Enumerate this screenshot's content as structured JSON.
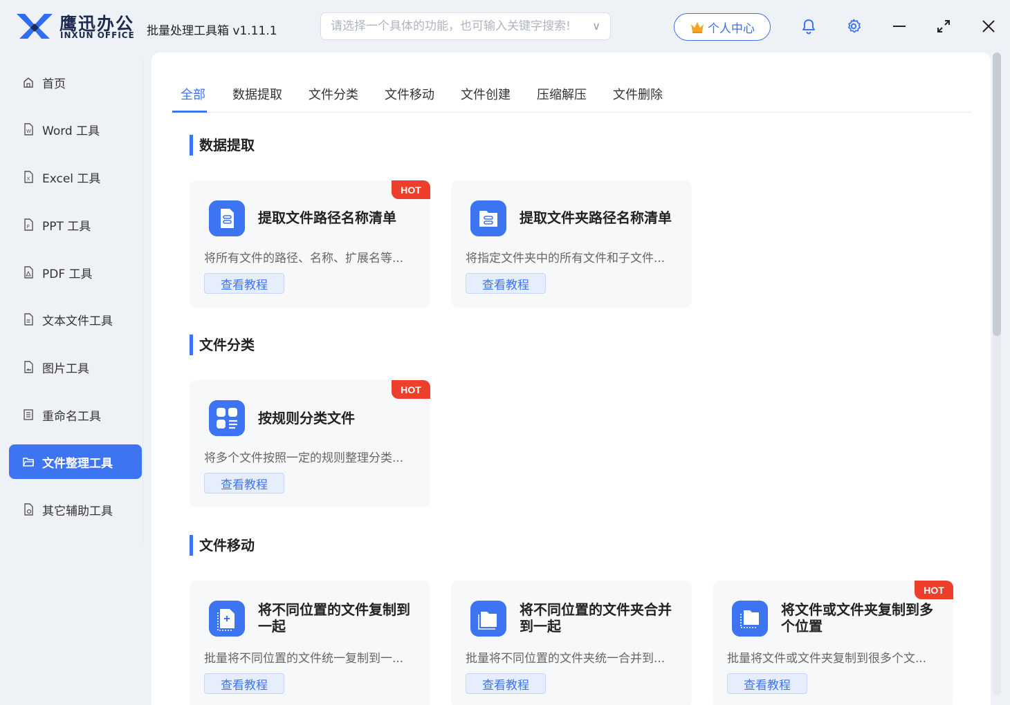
{
  "brand": {
    "name_cn": "鹰迅办公",
    "name_en": "INXUN OFFICE"
  },
  "app_title": "批量处理工具箱 v1.11.1",
  "search": {
    "placeholder": "请选择一个具体的功能，也可输入关键字搜索!"
  },
  "user_center": {
    "label": "个人中心"
  },
  "window_controls": [
    "bell-icon",
    "gear-icon",
    "minimize-icon",
    "maximize-icon",
    "close-icon"
  ],
  "colors": {
    "accent": "#3d74f2",
    "hot": "#ee3f2c",
    "sidebar_bg": "#eef1f6",
    "card_bg": "#f7f8fa"
  },
  "sidebar": {
    "items": [
      {
        "label": "首页",
        "icon": "home-icon"
      },
      {
        "label": "Word 工具",
        "icon": "word-file-icon"
      },
      {
        "label": "Excel 工具",
        "icon": "excel-file-icon"
      },
      {
        "label": "PPT 工具",
        "icon": "ppt-file-icon"
      },
      {
        "label": "PDF 工具",
        "icon": "pdf-file-icon"
      },
      {
        "label": "文本文件工具",
        "icon": "text-file-icon"
      },
      {
        "label": "图片工具",
        "icon": "image-file-icon"
      },
      {
        "label": "重命名工具",
        "icon": "rename-icon"
      },
      {
        "label": "文件整理工具",
        "icon": "folder-open-icon",
        "active": true
      },
      {
        "label": "其它辅助工具",
        "icon": "misc-tools-icon"
      }
    ]
  },
  "tabs": [
    "全部",
    "数据提取",
    "文件分类",
    "文件移动",
    "文件创建",
    "压缩解压",
    "文件删除"
  ],
  "active_tab": "全部",
  "hot_label": "HOT",
  "tutorial_label": "查看教程",
  "sections": [
    {
      "title": "数据提取",
      "cards": [
        {
          "title": "提取文件路径名称清单",
          "desc": "将所有文件的路径、名称、扩展名等...",
          "hot": true
        },
        {
          "title": "提取文件夹路径名称清单",
          "desc": "将指定文件夹中的所有文件和子文件...",
          "hot": false
        }
      ]
    },
    {
      "title": "文件分类",
      "cards": [
        {
          "title": "按规则分类文件",
          "desc": "将多个文件按照一定的规则整理分类...",
          "hot": true
        }
      ]
    },
    {
      "title": "文件移动",
      "cards": [
        {
          "title": "将不同位置的文件复制到一起",
          "desc": "批量将不同位置的文件统一复制到一...",
          "hot": false
        },
        {
          "title": "将不同位置的文件夹合并到一起",
          "desc": "批量将不同位置的文件夹统一合并到...",
          "hot": false
        },
        {
          "title": "将文件或文件夹复制到多个位置",
          "desc": "批量将文件或文件夹复制到很多个文...",
          "hot": true
        }
      ]
    }
  ]
}
